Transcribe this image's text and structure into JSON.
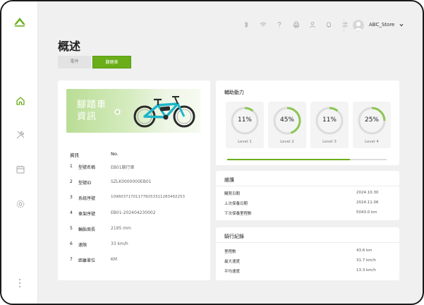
{
  "header": {
    "store_name": "ABC_Store",
    "icons": [
      "bluetooth-icon",
      "wifi-icon",
      "help-icon",
      "print-icon",
      "user-switch-icon",
      "bell-icon",
      "sliders-icon"
    ]
  },
  "sidebar": {
    "items": [
      "home-icon",
      "tools-icon",
      "calendar-icon",
      "settings-icon"
    ],
    "active": "home-icon"
  },
  "page": {
    "title": "概述",
    "tabs": [
      {
        "label": "零件",
        "active": false
      },
      {
        "label": "腳踏車",
        "active": true
      }
    ]
  },
  "bike_info": {
    "banner_title": "腳踏車資訊",
    "columns": {
      "label": "資訊",
      "value": "No."
    },
    "rows": [
      {
        "index": "1",
        "label": "型號名稱",
        "value": "EB01競行車"
      },
      {
        "index": "2",
        "label": "型號ID",
        "value": "SZLK0000000EB01"
      },
      {
        "index": "3",
        "label": "系統序號",
        "value": "109603717011778253311283492253"
      },
      {
        "index": "4",
        "label": "車架序號",
        "value": "EB01-202404230002"
      },
      {
        "index": "5",
        "label": "輪胎周長",
        "value": "2195 mm"
      },
      {
        "index": "6",
        "label": "速限",
        "value": "33 km/h"
      },
      {
        "index": "7",
        "label": "距離單位",
        "value": "KM"
      }
    ]
  },
  "assist": {
    "title": "輔助動力",
    "levels": [
      {
        "label": "Level 1",
        "value": "11%",
        "fraction": 0.11
      },
      {
        "label": "Level 2",
        "value": "45%",
        "fraction": 0.45
      },
      {
        "label": "Level 3",
        "value": "11%",
        "fraction": 0.11
      },
      {
        "label": "Level 4",
        "value": "25%",
        "fraction": 0.25
      }
    ],
    "progress_fraction": 0.77
  },
  "maintenance": {
    "title": "維護",
    "rows": [
      {
        "label": "購買日期",
        "value": "2024.10.30"
      },
      {
        "label": "上次保養日期",
        "value": "2024.11.06"
      },
      {
        "label": "下次保養里程數",
        "value": "5043.0 km"
      }
    ]
  },
  "ride_log": {
    "title": "騎行紀錄",
    "rows": [
      {
        "label": "里程數",
        "value": "43.6 km"
      },
      {
        "label": "最大速度",
        "value": "31.7 km/h"
      },
      {
        "label": "平均速度",
        "value": "13.3 km/h"
      }
    ]
  },
  "colors": {
    "accent": "#6aae1a",
    "track": "#dcdcdc"
  }
}
